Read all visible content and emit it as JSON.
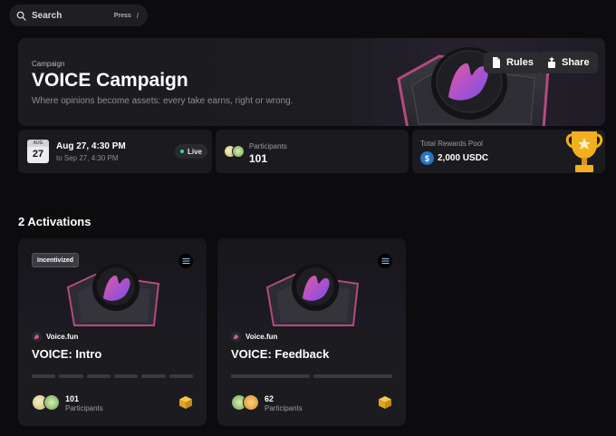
{
  "search": {
    "label": "Search",
    "shortcut_press": "Press",
    "shortcut_key": "/"
  },
  "campaign": {
    "label": "Campaign",
    "title": "VOICE Campaign",
    "subtitle": "Where opinions become assets: every take earns, right or wrong.",
    "rules_label": "Rules",
    "share_label": "Share"
  },
  "dates": {
    "month": "AUG",
    "day": "27",
    "start": "Aug 27, 4:30 PM",
    "end": "to Sep 27, 4:30 PM",
    "status": "Live"
  },
  "participants": {
    "label": "Participants",
    "count": "101"
  },
  "rewards": {
    "label": "Total Rewards Pool",
    "amount": "2,000 USDC",
    "token_icon": "usdc-icon"
  },
  "activations": {
    "heading": "2 Activations",
    "items": [
      {
        "badge": "Incentivized",
        "platform": "Voice.fun",
        "title": "VOICE: Intro",
        "steps": 6,
        "participants_count": "101",
        "participants_label": "Participants"
      },
      {
        "badge": "",
        "platform": "Voice.fun",
        "title": "VOICE: Feedback",
        "steps": 2,
        "participants_count": "62",
        "participants_label": "Participants"
      }
    ]
  },
  "colors": {
    "live": "#3ddc84",
    "accent_pink": "#d65aa0",
    "accent_purple": "#7a4cf0",
    "usdc": "#2775ca"
  }
}
